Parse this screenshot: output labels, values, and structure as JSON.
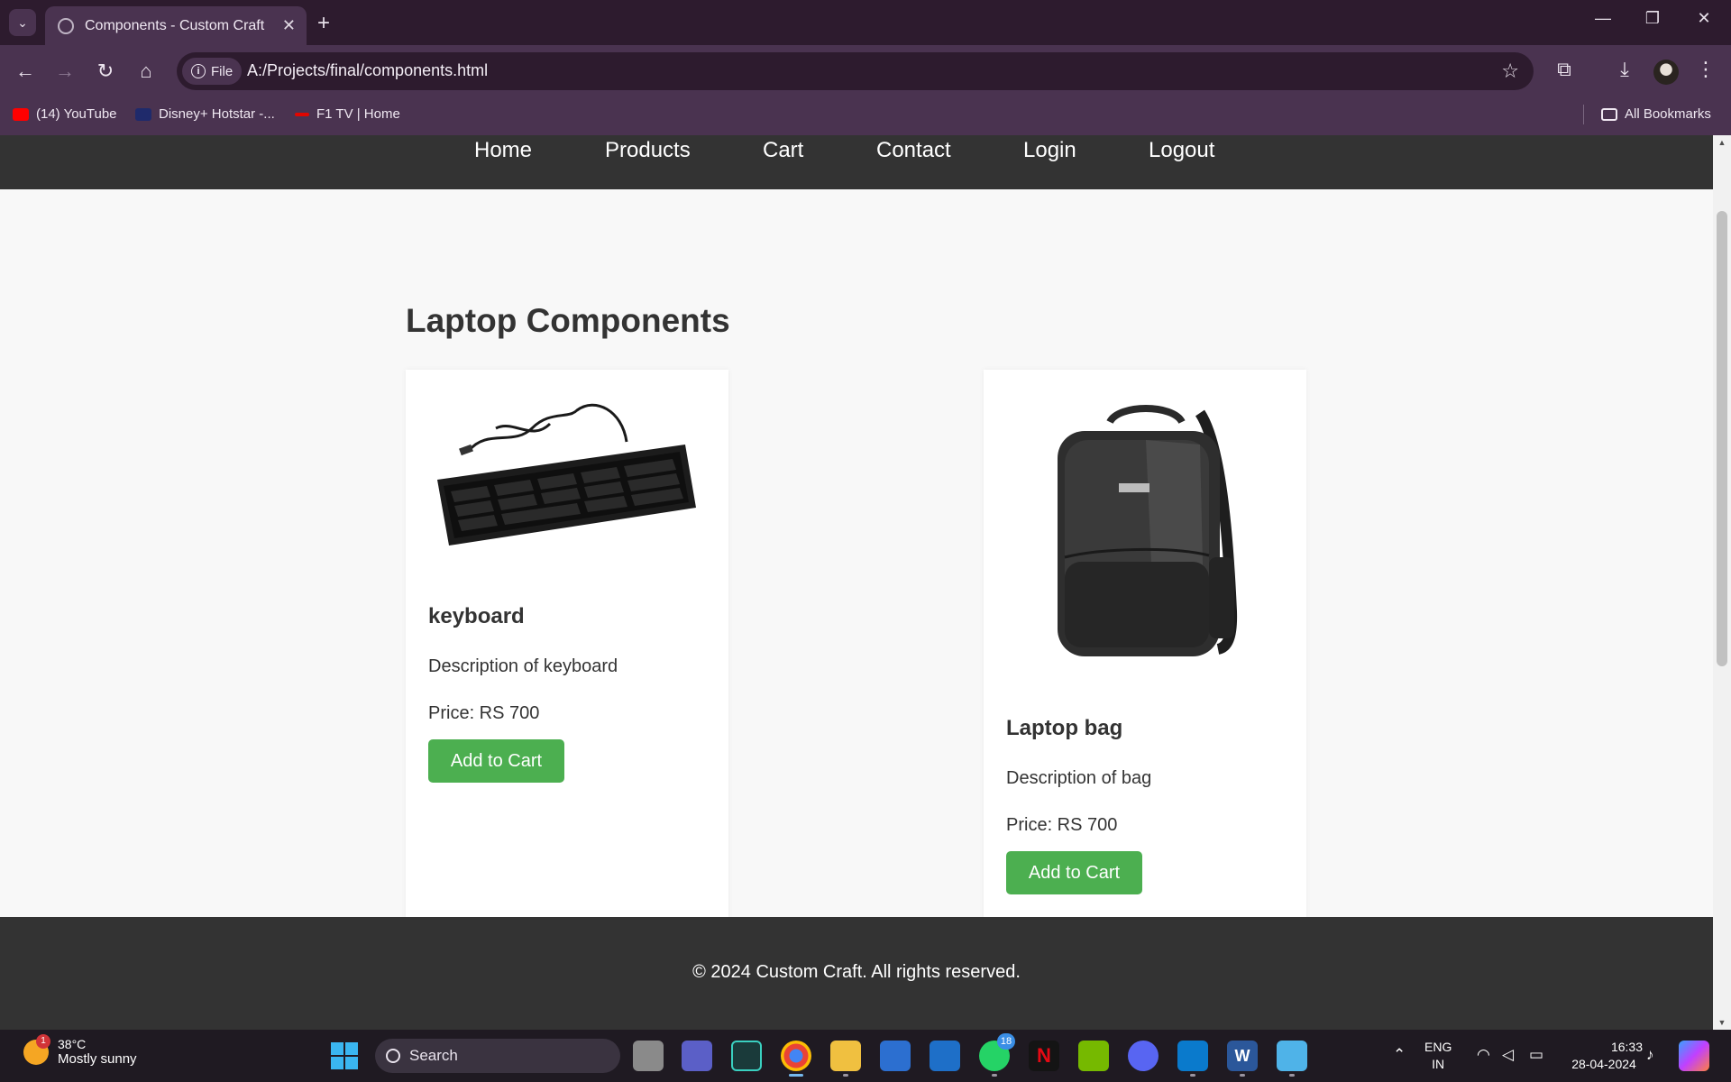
{
  "browser": {
    "tab_title": "Components - Custom Craft",
    "url": "A:/Projects/final/components.html",
    "scheme_chip": "File",
    "bookmarks": [
      {
        "label": "(14) YouTube",
        "icon": "youtube-icon",
        "color": "#ff0000"
      },
      {
        "label": "Disney+ Hotstar -...",
        "icon": "hotstar-icon",
        "color": "#1f2a6b"
      },
      {
        "label": "F1 TV | Home",
        "icon": "f1-icon",
        "color": "#e10600"
      }
    ],
    "all_bookmarks": "All Bookmarks"
  },
  "site": {
    "nav": [
      "Home",
      "Products",
      "Cart",
      "Contact",
      "Login",
      "Logout"
    ],
    "heading": "Laptop Components",
    "products": [
      {
        "name": "keyboard",
        "description": "Description of keyboard",
        "price": "Price: RS 700",
        "button": "Add to Cart",
        "image": "keyboard-image"
      },
      {
        "name": "Laptop bag",
        "description": "Description of bag",
        "price": "Price: RS 700",
        "button": "Add to Cart",
        "image": "backpack-image"
      }
    ],
    "footer": "© 2024 Custom Craft. All rights reserved.",
    "accent_color": "#4caf50"
  },
  "taskbar": {
    "weather": {
      "temp": "38°C",
      "condition": "Mostly sunny",
      "badge": "1"
    },
    "search_label": "Search",
    "whatsapp_badge": "18",
    "lang_line1": "ENG",
    "lang_line2": "IN",
    "time": "16:33",
    "date": "28-04-2024"
  }
}
